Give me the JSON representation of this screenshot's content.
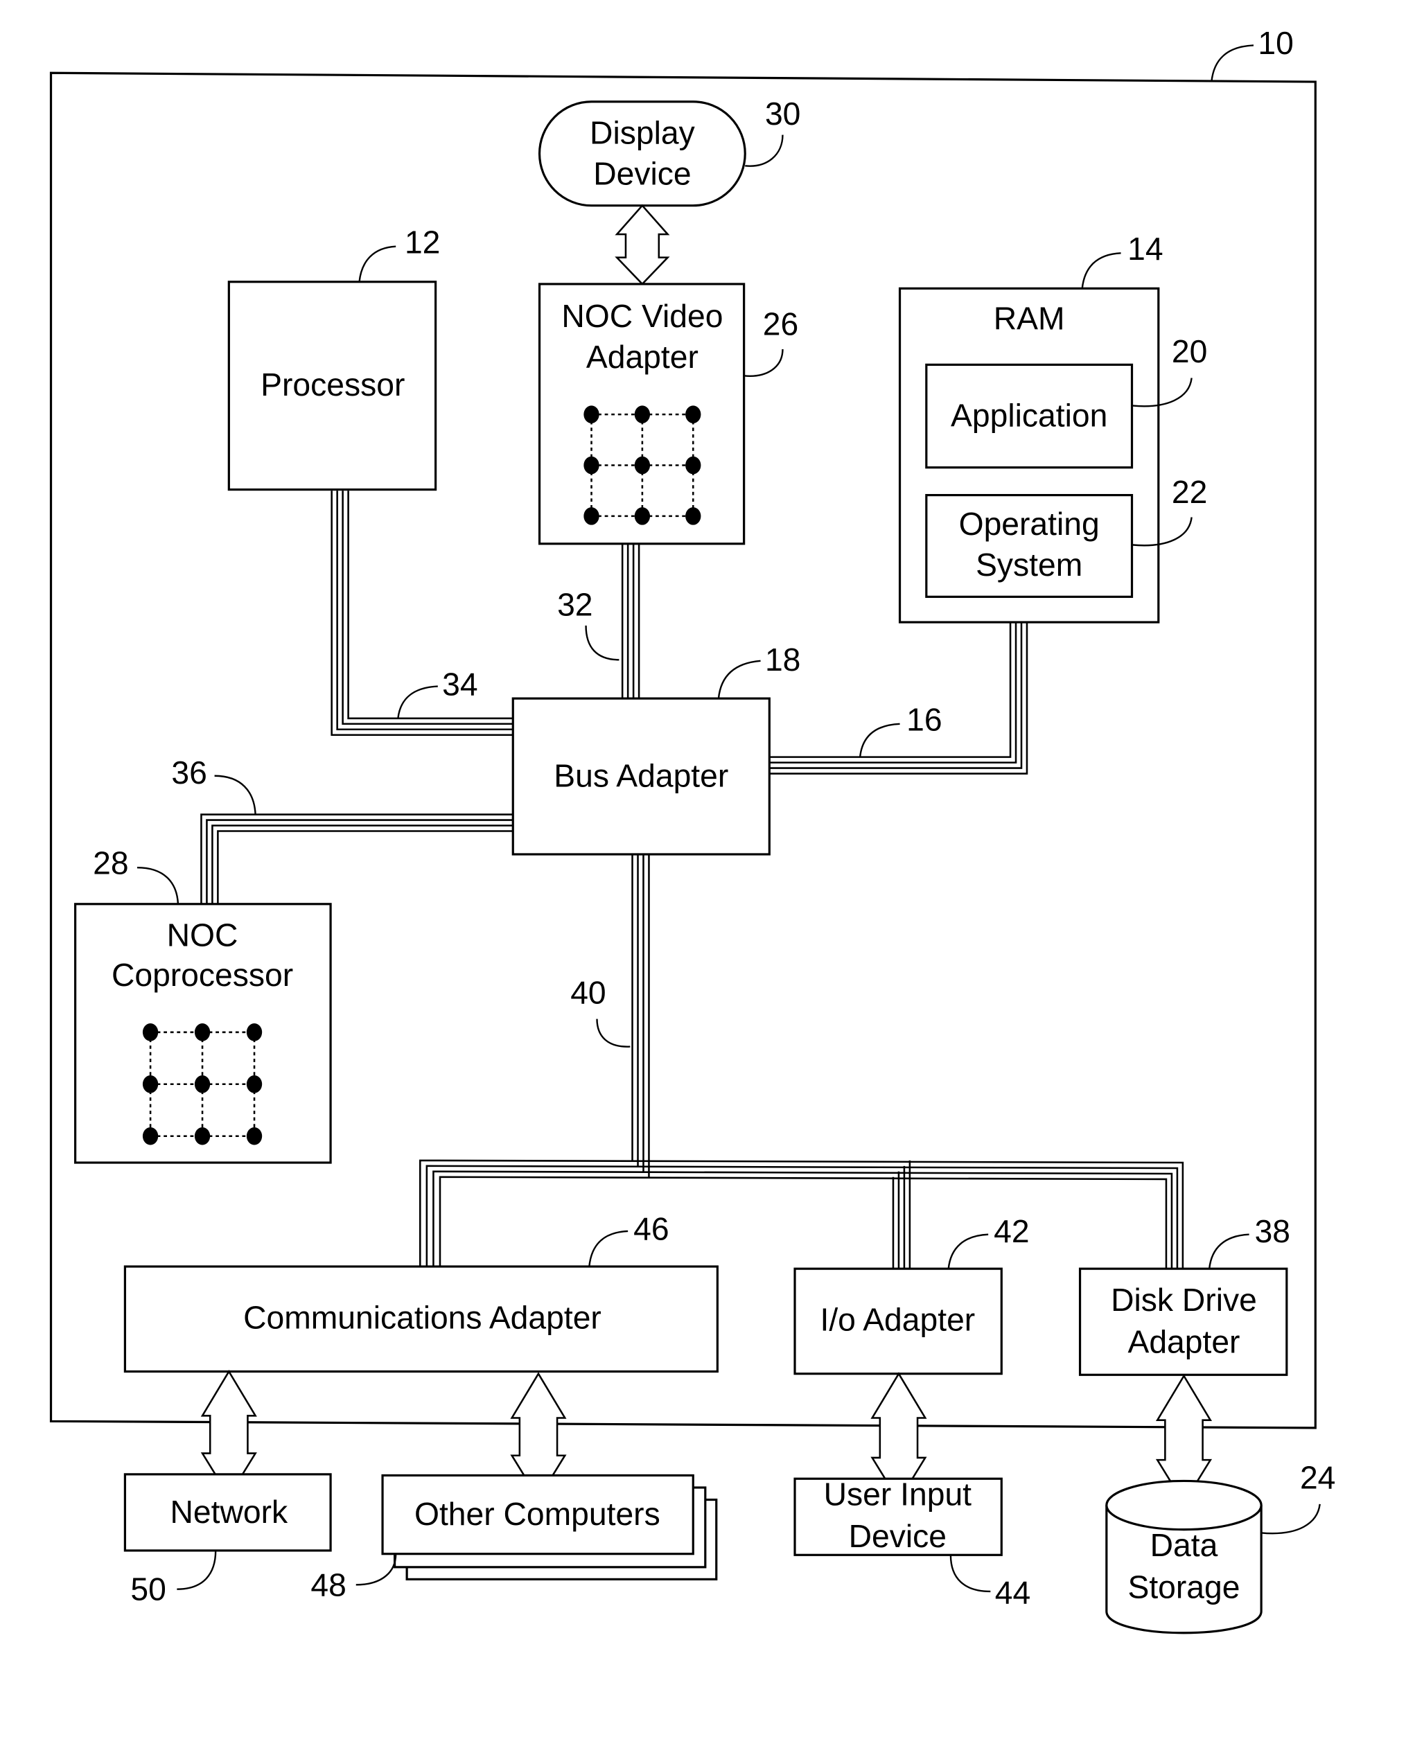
{
  "diagram": {
    "type": "computer system block diagram",
    "system": {
      "ref": "10"
    },
    "components": {
      "display_device": {
        "label_lines": [
          "Display",
          "Device"
        ],
        "ref": "30"
      },
      "processor": {
        "label_lines": [
          "Processor"
        ],
        "ref": "12"
      },
      "noc_video_adapter": {
        "label_lines": [
          "NOC Video",
          "Adapter"
        ],
        "ref": "26"
      },
      "ram": {
        "label_lines": [
          "RAM"
        ],
        "ref": "14"
      },
      "application": {
        "label_lines": [
          "Application"
        ],
        "ref": "20"
      },
      "operating_system": {
        "label_lines": [
          "Operating",
          "System"
        ],
        "ref": "22"
      },
      "bus_adapter": {
        "label_lines": [
          "Bus Adapter"
        ],
        "ref": "18"
      },
      "noc_coprocessor": {
        "label_lines": [
          "NOC",
          "Coprocessor"
        ],
        "ref": "28"
      },
      "communications_adapter": {
        "label_lines": [
          "Communications Adapter"
        ],
        "ref": "46"
      },
      "io_adapter": {
        "label_lines": [
          "I/o Adapter"
        ],
        "ref": "42"
      },
      "disk_drive_adapter": {
        "label_lines": [
          "Disk Drive",
          "Adapter"
        ],
        "ref": "38"
      },
      "network": {
        "label_lines": [
          "Network"
        ],
        "ref": "50"
      },
      "other_computers": {
        "label_lines": [
          "Other Computers"
        ],
        "ref": "48"
      },
      "user_input_device": {
        "label_lines": [
          "User Input",
          "Device"
        ],
        "ref": "44"
      },
      "data_storage": {
        "label_lines": [
          "Data",
          "Storage"
        ],
        "ref": "24"
      }
    },
    "buses": {
      "memory_bus": {
        "ref": "16",
        "connects": [
          "bus_adapter",
          "ram"
        ]
      },
      "video_bus": {
        "ref": "32",
        "connects": [
          "bus_adapter",
          "noc_video_adapter"
        ]
      },
      "front_side_bus": {
        "ref": "34",
        "connects": [
          "bus_adapter",
          "processor"
        ]
      },
      "coprocessor_bus": {
        "ref": "36",
        "connects": [
          "bus_adapter",
          "noc_coprocessor"
        ]
      },
      "expansion_bus": {
        "ref": "40",
        "connects": [
          "bus_adapter",
          "communications_adapter",
          "io_adapter",
          "disk_drive_adapter"
        ]
      }
    },
    "links": [
      [
        "display_device",
        "noc_video_adapter"
      ],
      [
        "communications_adapter",
        "network"
      ],
      [
        "communications_adapter",
        "other_computers"
      ],
      [
        "io_adapter",
        "user_input_device"
      ],
      [
        "disk_drive_adapter",
        "data_storage"
      ]
    ],
    "noc_mesh": {
      "rows": 3,
      "cols": 3
    }
  }
}
